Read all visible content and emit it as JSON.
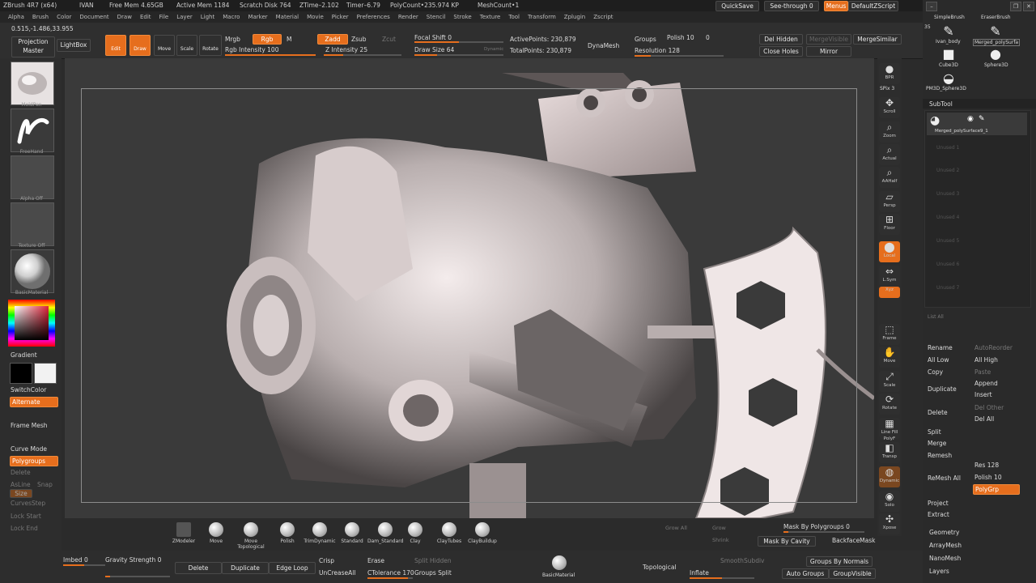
{
  "titlebar": {
    "app": "ZBrush 4R7 (x64)",
    "user": "IVAN",
    "stats": [
      "Free Mem 4.65GB",
      "Active Mem 1184",
      "Scratch Disk 764",
      "ZTime–2.102",
      "Timer–6.79",
      "PolyCount•235.974 KP",
      "MeshCount•1"
    ],
    "quicksave": "QuickSave",
    "see_through": "See-through  0",
    "menus": "Menus",
    "script": "DefaultZScript"
  },
  "menubar": [
    "Alpha",
    "Brush",
    "Color",
    "Document",
    "Draw",
    "Edit",
    "File",
    "Layer",
    "Light",
    "Macro",
    "Marker",
    "Material",
    "Movie",
    "Picker",
    "Preferences",
    "Render",
    "Stencil",
    "Stroke",
    "Texture",
    "Tool",
    "Transform",
    "Zplugin",
    "Zscript"
  ],
  "coords": "0.515,-1.486,33.955",
  "toolbar": {
    "projection_master": "Projection Master",
    "lightbox": "LightBox",
    "edit": "Edit",
    "draw": "Draw",
    "move": "Move",
    "scale": "Scale",
    "rotate": "Rotate",
    "mrgb": "Mrgb",
    "rgb": "Rgb",
    "m": "M",
    "rgb_intensity": "Rgb Intensity 100",
    "zadd": "Zadd",
    "zsub": "Zsub",
    "zcut": "Zcut",
    "z_intensity": "Z Intensity 25",
    "focal_shift": "Focal Shift 0",
    "draw_size": "Draw Size 64",
    "dynamic": "Dynamic",
    "active_points": "ActivePoints: 230,879",
    "total_points": "TotalPoints: 230,879",
    "dynamesh": "DynaMesh",
    "groups": "Groups",
    "polish": "Polish 10",
    "polish_val": "0",
    "resolution": "Resolution 128",
    "del_hidden": "Del Hidden",
    "merge_visible": "MergeVisible",
    "merge_similar": "MergeSimilar",
    "close_holes": "Close Holes",
    "mirror": "Mirror"
  },
  "leftpanel": {
    "brush": "MoldPen",
    "stroke": "FreeHand",
    "alpha": "Alpha Off",
    "texture": "Texture Off",
    "material": "BasicMaterial",
    "gradient": "Gradient",
    "switch_color": "SwitchColor",
    "alternate": "Alternate",
    "frame_mesh": "Frame Mesh",
    "curve_mode": "Curve Mode",
    "polygroups": "Polygroups",
    "delete": "Delete",
    "as_line": "AsLine",
    "snap": "Snap",
    "size": "Size",
    "curves_step": "CurvesStep",
    "lock_start": "Lock Start",
    "lock_end": "Lock End"
  },
  "rightnav": [
    "BPR",
    "SPix 3",
    "Scroll",
    "Zoom",
    "Actual",
    "AAHalf",
    "Persp",
    "Floor",
    "Local",
    "L.Sym",
    "Xyz",
    "Frame",
    "Move",
    "Scale",
    "Rotate",
    "Line Fill PolyF",
    "Transp",
    "Dynamic",
    "Solo",
    "Xpose"
  ],
  "tools": {
    "count": "35",
    "items": [
      "SimpleBrush",
      "EraserBrush",
      "Ivan_body",
      "Merged_polySurfa",
      "Cube3D",
      "Sphere3D",
      "PM3D_Sphere3D"
    ]
  },
  "subtool": {
    "header": "SubTool",
    "active": "Merged_polySurface9_1",
    "slots": [
      "Unused 1",
      "Unused 2",
      "Unused 3",
      "Unused 4",
      "Unused 5",
      "Unused 6",
      "Unused 7"
    ],
    "list_all": "List All",
    "rename": "Rename",
    "auto_reorder": "AutoReorder",
    "all_low": "All Low",
    "all_high": "All High",
    "copy": "Copy",
    "paste": "Paste",
    "duplicate": "Duplicate",
    "append": "Append",
    "insert": "Insert",
    "delete": "Delete",
    "del_other": "Del Other",
    "del_all": "Del All",
    "split": "Split",
    "merge": "Merge",
    "remesh": "Remesh",
    "remesh_all": "ReMesh All",
    "res": "Res 128",
    "polish": "Polish 10",
    "polygrp": "PolyGrp",
    "project": "Project",
    "extract": "Extract",
    "geometry": "Geometry",
    "arraymesh": "ArrayMesh",
    "nanomesh": "NanoMesh",
    "layers": "Layers"
  },
  "shelf": {
    "brushes": [
      "ZModeler",
      "Move",
      "Move Topological",
      "Polish",
      "TrimDynamic",
      "Standard",
      "Dam_Standard",
      "Clay",
      "ClayTubes",
      "ClayBuildup"
    ],
    "grow_all": "Grow All",
    "grow": "Grow",
    "shrink": "Shrink",
    "mask_by_polygroups": "Mask By Polygroups 0",
    "mask_by_cavity": "Mask By Cavity",
    "backface_mask": "BackfaceMask"
  },
  "bottom": {
    "imbed": "Imbed 0",
    "gravity": "Gravity Strength 0",
    "delete": "Delete",
    "duplicate": "Duplicate",
    "edge_loop": "Edge Loop",
    "crisp": "Crisp",
    "erase": "Erase",
    "split_hidden": "Split Hidden",
    "unc_crease": "UnCreaseAll",
    "ctolerance": "CTolerance 170",
    "groups_split": "Groups Split",
    "material": "BasicMaterial",
    "topological": "Topological",
    "inflate": "Inflate",
    "smooth_subdiv": "SmoothSubdiv",
    "groups_by_normals": "Groups By Normals",
    "auto_groups": "Auto Groups",
    "group_visible": "GroupVisible"
  }
}
